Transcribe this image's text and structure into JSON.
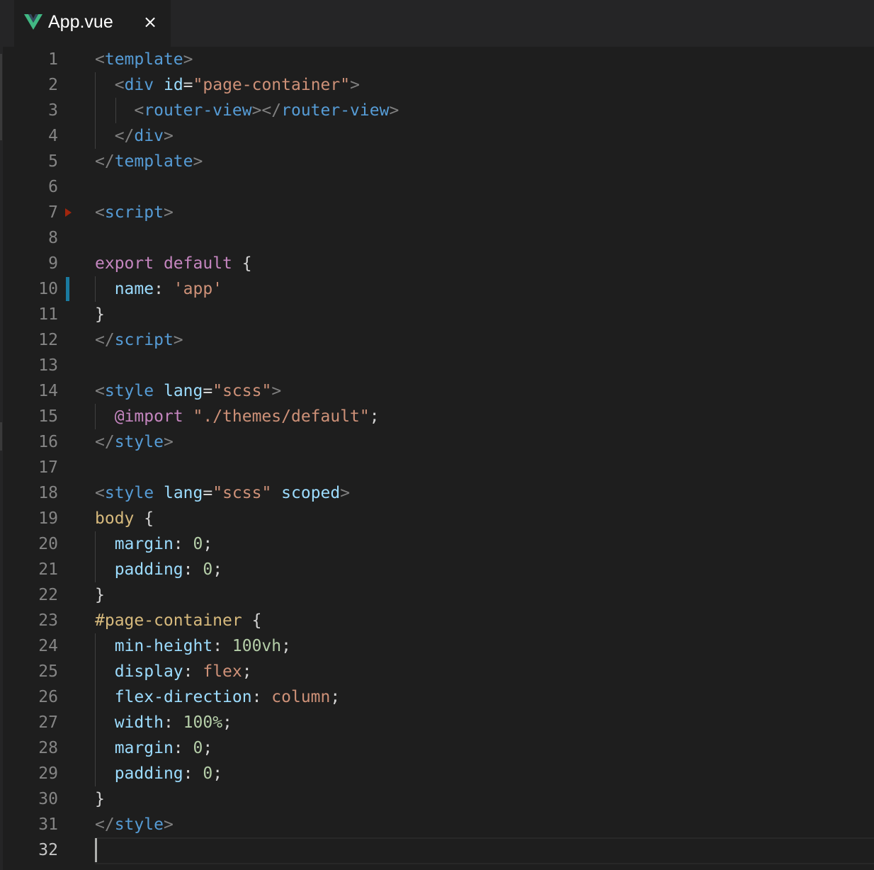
{
  "tab": {
    "icon": "vue-logo-icon",
    "label": "App.vue",
    "close_glyph": "×"
  },
  "colors": {
    "punct": "#808080",
    "tag": "#569cd6",
    "attr": "#9cdcfe",
    "string": "#ce9178",
    "keyword": "#c586c0",
    "property": "#9cdcfe",
    "number": "#b5cea8",
    "selector": "#d7ba7d",
    "text": "#d4d4d4",
    "line_number": "#858585",
    "modified_gutter": "#1a7aa0",
    "vue_green": "#41b883"
  },
  "editor": {
    "current_line": 32,
    "modified_line": 10,
    "marker_line": 8,
    "lines": [
      {
        "n": "1",
        "tokens": [
          [
            "punct",
            "<"
          ],
          [
            "tag",
            "template"
          ],
          [
            "punct",
            ">"
          ]
        ]
      },
      {
        "n": "2",
        "tokens": [
          [
            "text",
            "  "
          ],
          [
            "punct",
            "<"
          ],
          [
            "tag",
            "div"
          ],
          [
            "text",
            " "
          ],
          [
            "attr",
            "id"
          ],
          [
            "text",
            "="
          ],
          [
            "str",
            "\"page-container\""
          ],
          [
            "punct",
            ">"
          ]
        ]
      },
      {
        "n": "3",
        "tokens": [
          [
            "text",
            "    "
          ],
          [
            "punct",
            "<"
          ],
          [
            "tag",
            "router-view"
          ],
          [
            "punct",
            "></"
          ],
          [
            "tag",
            "router-view"
          ],
          [
            "punct",
            ">"
          ]
        ]
      },
      {
        "n": "4",
        "tokens": [
          [
            "text",
            "  "
          ],
          [
            "punct",
            "</"
          ],
          [
            "tag",
            "div"
          ],
          [
            "punct",
            ">"
          ]
        ]
      },
      {
        "n": "5",
        "tokens": [
          [
            "punct",
            "</"
          ],
          [
            "tag",
            "template"
          ],
          [
            "punct",
            ">"
          ]
        ]
      },
      {
        "n": "6",
        "tokens": []
      },
      {
        "n": "7",
        "tokens": [
          [
            "punct",
            "<"
          ],
          [
            "tag",
            "script"
          ],
          [
            "punct",
            ">"
          ]
        ]
      },
      {
        "n": "8",
        "tokens": []
      },
      {
        "n": "9",
        "tokens": [
          [
            "kw",
            "export"
          ],
          [
            "text",
            " "
          ],
          [
            "kw",
            "default"
          ],
          [
            "text",
            " {"
          ]
        ]
      },
      {
        "n": "10",
        "tokens": [
          [
            "text",
            "  "
          ],
          [
            "prop",
            "name"
          ],
          [
            "text",
            ": "
          ],
          [
            "str",
            "'app'"
          ]
        ]
      },
      {
        "n": "11",
        "tokens": [
          [
            "text",
            "}"
          ]
        ]
      },
      {
        "n": "12",
        "tokens": [
          [
            "punct",
            "</"
          ],
          [
            "tag",
            "script"
          ],
          [
            "punct",
            ">"
          ]
        ]
      },
      {
        "n": "13",
        "tokens": []
      },
      {
        "n": "14",
        "tokens": [
          [
            "punct",
            "<"
          ],
          [
            "tag",
            "style"
          ],
          [
            "text",
            " "
          ],
          [
            "attr",
            "lang"
          ],
          [
            "text",
            "="
          ],
          [
            "str",
            "\"scss\""
          ],
          [
            "punct",
            ">"
          ]
        ]
      },
      {
        "n": "15",
        "tokens": [
          [
            "text",
            "  "
          ],
          [
            "kw",
            "@import"
          ],
          [
            "text",
            " "
          ],
          [
            "str",
            "\"./themes/default\""
          ],
          [
            "text",
            ";"
          ]
        ]
      },
      {
        "n": "16",
        "tokens": [
          [
            "punct",
            "</"
          ],
          [
            "tag",
            "style"
          ],
          [
            "punct",
            ">"
          ]
        ]
      },
      {
        "n": "17",
        "tokens": []
      },
      {
        "n": "18",
        "tokens": [
          [
            "punct",
            "<"
          ],
          [
            "tag",
            "style"
          ],
          [
            "text",
            " "
          ],
          [
            "attr",
            "lang"
          ],
          [
            "text",
            "="
          ],
          [
            "str",
            "\"scss\""
          ],
          [
            "text",
            " "
          ],
          [
            "attr",
            "scoped"
          ],
          [
            "punct",
            ">"
          ]
        ]
      },
      {
        "n": "19",
        "tokens": [
          [
            "sel",
            "body"
          ],
          [
            "text",
            " {"
          ]
        ]
      },
      {
        "n": "20",
        "tokens": [
          [
            "text",
            "  "
          ],
          [
            "prop",
            "margin"
          ],
          [
            "text",
            ": "
          ],
          [
            "num",
            "0"
          ],
          [
            "text",
            ";"
          ]
        ]
      },
      {
        "n": "21",
        "tokens": [
          [
            "text",
            "  "
          ],
          [
            "prop",
            "padding"
          ],
          [
            "text",
            ": "
          ],
          [
            "num",
            "0"
          ],
          [
            "text",
            ";"
          ]
        ]
      },
      {
        "n": "22",
        "tokens": [
          [
            "text",
            "}"
          ]
        ]
      },
      {
        "n": "23",
        "tokens": [
          [
            "sel",
            "#page-container"
          ],
          [
            "text",
            " {"
          ]
        ]
      },
      {
        "n": "24",
        "tokens": [
          [
            "text",
            "  "
          ],
          [
            "prop",
            "min-height"
          ],
          [
            "text",
            ": "
          ],
          [
            "num",
            "100vh"
          ],
          [
            "text",
            ";"
          ]
        ]
      },
      {
        "n": "25",
        "tokens": [
          [
            "text",
            "  "
          ],
          [
            "prop",
            "display"
          ],
          [
            "text",
            ": "
          ],
          [
            "str",
            "flex"
          ],
          [
            "text",
            ";"
          ]
        ]
      },
      {
        "n": "26",
        "tokens": [
          [
            "text",
            "  "
          ],
          [
            "prop",
            "flex-direction"
          ],
          [
            "text",
            ": "
          ],
          [
            "str",
            "column"
          ],
          [
            "text",
            ";"
          ]
        ]
      },
      {
        "n": "27",
        "tokens": [
          [
            "text",
            "  "
          ],
          [
            "prop",
            "width"
          ],
          [
            "text",
            ": "
          ],
          [
            "num",
            "100%"
          ],
          [
            "text",
            ";"
          ]
        ]
      },
      {
        "n": "28",
        "tokens": [
          [
            "text",
            "  "
          ],
          [
            "prop",
            "margin"
          ],
          [
            "text",
            ": "
          ],
          [
            "num",
            "0"
          ],
          [
            "text",
            ";"
          ]
        ]
      },
      {
        "n": "29",
        "tokens": [
          [
            "text",
            "  "
          ],
          [
            "prop",
            "padding"
          ],
          [
            "text",
            ": "
          ],
          [
            "num",
            "0"
          ],
          [
            "text",
            ";"
          ]
        ]
      },
      {
        "n": "30",
        "tokens": [
          [
            "text",
            "}"
          ]
        ]
      },
      {
        "n": "31",
        "tokens": [
          [
            "punct",
            "</"
          ],
          [
            "tag",
            "style"
          ],
          [
            "punct",
            ">"
          ]
        ]
      },
      {
        "n": "32",
        "tokens": []
      }
    ]
  }
}
